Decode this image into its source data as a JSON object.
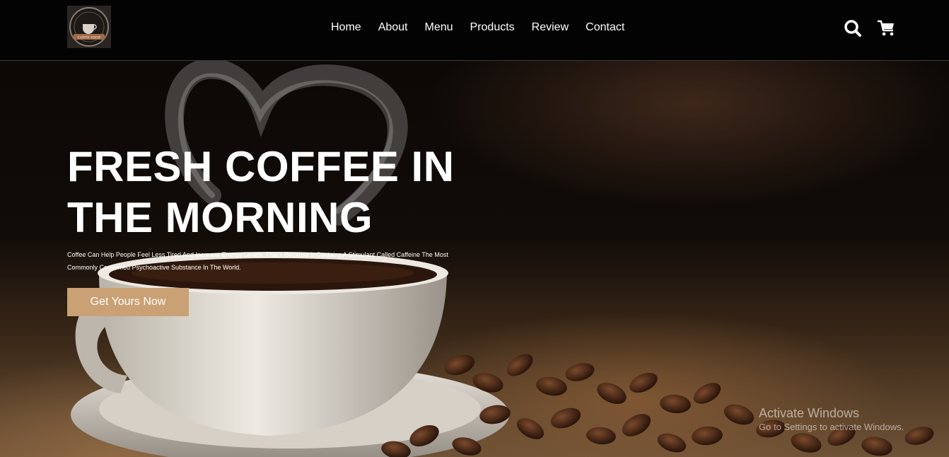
{
  "header": {
    "logo_alt": "Coffee Shop logo",
    "logo_text": "COFFE SHOP",
    "nav": [
      {
        "label": "Home"
      },
      {
        "label": "About"
      },
      {
        "label": "Menu"
      },
      {
        "label": "Products"
      },
      {
        "label": "Review"
      },
      {
        "label": "Contact"
      }
    ],
    "icons": [
      "search-icon",
      "cart-icon"
    ]
  },
  "hero": {
    "title": "FRESH COFFEE IN THE MORNING",
    "description": "Coffee Can Help People Feel Less Tired And Increase Energy Levels. That's Because It Contains A Stimulant Called Caffeine The Most Commonly Consumed Psychoactive Substance In The World.",
    "cta_label": "Get Yours Now"
  },
  "watermark": {
    "title": "Activate Windows",
    "subtitle": "Go to Settings to activate Windows."
  },
  "colors": {
    "header_bg": "#030304",
    "accent": "#c9a175",
    "text": "#ffffff"
  }
}
